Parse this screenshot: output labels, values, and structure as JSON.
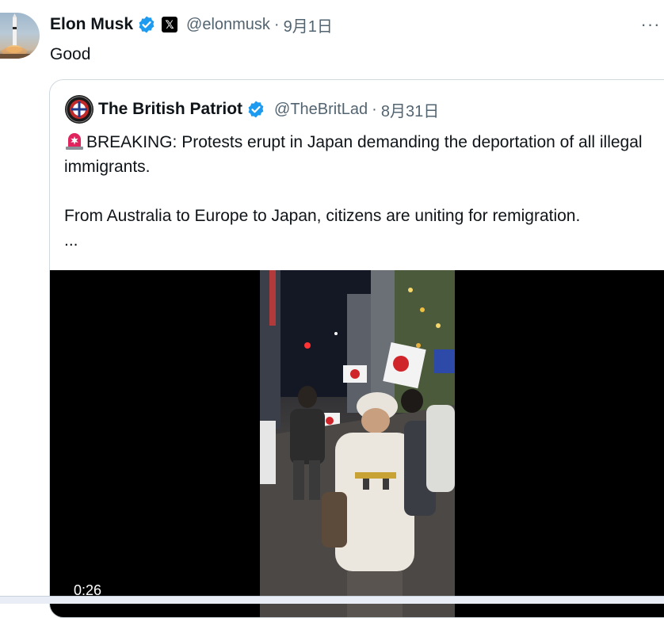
{
  "tweet": {
    "author": {
      "display_name": "Elon Musk",
      "handle": "@elonmusk",
      "verified_icon": "verified-badge-icon",
      "affiliation_icon": "x-logo-icon",
      "affiliation_glyph": "𝕏"
    },
    "separator": "·",
    "date": "9月1日",
    "text": "Good",
    "more_icon": "more-options-icon",
    "more_glyph": "···"
  },
  "quote": {
    "author": {
      "display_name": "The British Patriot",
      "handle": "@TheBritLad",
      "verified_icon": "verified-badge-icon"
    },
    "separator": "·",
    "date": "8月31日",
    "text_line1": "BREAKING: Protests erupt in Japan demanding the deportation of all illegal immigrants.",
    "text_line2": "From Australia to Europe to Japan, citizens are uniting for remigration.",
    "ellipsis": "...",
    "siren_icon": "rotating-light-emoji-icon"
  },
  "video": {
    "duration": "0:26"
  },
  "colors": {
    "text_primary": "#0f1419",
    "text_secondary": "#536471",
    "verified_blue": "#1d9bf0",
    "card_border": "#cfd9de",
    "video_bg": "#000000"
  }
}
